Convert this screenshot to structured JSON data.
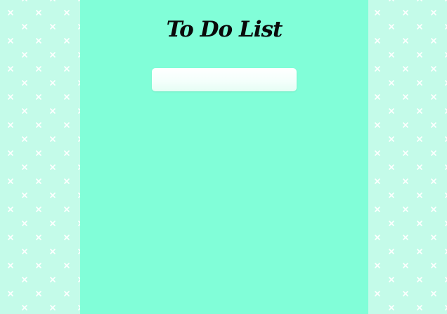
{
  "app": {
    "title": "To Do List"
  },
  "task_input": {
    "value": "",
    "placeholder": ""
  },
  "colors": {
    "panel_background": "#81fed8",
    "side_background": "#c4fbe9",
    "pattern_mark": "#ffffff",
    "title_text": "#0a0a0a"
  },
  "icons": {
    "background_pattern": "x-mark-pattern"
  }
}
